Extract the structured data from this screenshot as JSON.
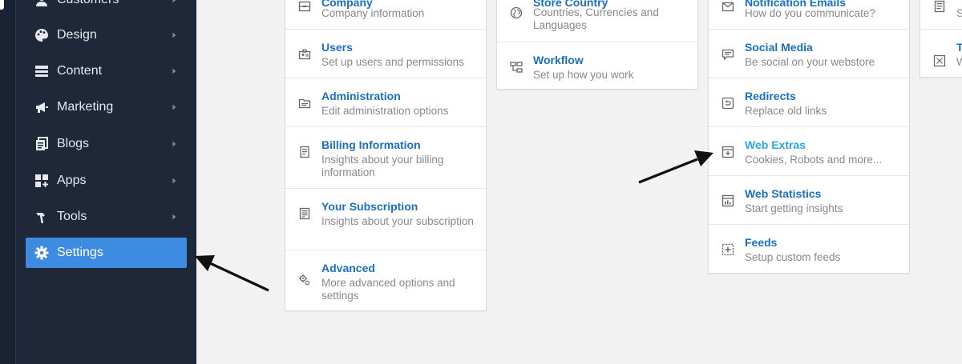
{
  "sidebar": {
    "items": [
      {
        "label": "Customers",
        "icon": "customers-icon"
      },
      {
        "label": "Design",
        "icon": "palette-icon"
      },
      {
        "label": "Content",
        "icon": "content-icon"
      },
      {
        "label": "Marketing",
        "icon": "megaphone-icon"
      },
      {
        "label": "Blogs",
        "icon": "blogs-icon"
      },
      {
        "label": "Apps",
        "icon": "apps-icon"
      },
      {
        "label": "Tools",
        "icon": "hammer-icon"
      },
      {
        "label": "Settings",
        "icon": "gear-icon",
        "active": true
      }
    ]
  },
  "columns": [
    {
      "items": [
        {
          "title": "Company",
          "desc": "Company information",
          "icon": "company-icon"
        },
        {
          "title": "Users",
          "desc": "Set up users and permissions",
          "icon": "users-icon"
        },
        {
          "title": "Administration",
          "desc": "Edit administration options",
          "icon": "administration-icon"
        },
        {
          "title": "Billing Information",
          "desc": "Insights about your billing information",
          "icon": "billing-icon"
        },
        {
          "title": "Your Subscription",
          "desc": "Insights about your subscription",
          "icon": "subscription-icon"
        },
        {
          "title": "Advanced",
          "desc": "More advanced options and settings",
          "icon": "advanced-gear-icon"
        }
      ]
    },
    {
      "items": [
        {
          "title": "Store Country",
          "desc": "Countries, Currencies and Languages",
          "icon": "globe-icon"
        },
        {
          "title": "Workflow",
          "desc": "Set up how you work",
          "icon": "workflow-icon"
        }
      ]
    },
    {
      "items": [
        {
          "title": "Notification Emails",
          "desc": "How do you communicate?",
          "icon": "email-icon"
        },
        {
          "title": "Social Media",
          "desc": "Be social on your webstore",
          "icon": "chat-icon"
        },
        {
          "title": "Redirects",
          "desc": "Replace old links",
          "icon": "redirect-icon"
        },
        {
          "title": "Web Extras",
          "desc": "Cookies, Robots and more...",
          "icon": "web-extras-icon",
          "highlight": true
        },
        {
          "title": "Web Statistics",
          "desc": "Start getting insights",
          "icon": "statistics-icon"
        },
        {
          "title": "Feeds",
          "desc": "Setup custom feeds",
          "icon": "feeds-icon"
        }
      ]
    },
    {
      "items": [
        {
          "title": "T",
          "desc": "S",
          "icon": "document-icon"
        },
        {
          "title": "T",
          "desc": "W",
          "icon": "tax-icon"
        }
      ]
    }
  ],
  "colors": {
    "sidebar_bg": "#1e2838",
    "active_bg": "#3d8ce1",
    "link": "#1a6fc2",
    "link_highlight": "#27a6e8"
  }
}
